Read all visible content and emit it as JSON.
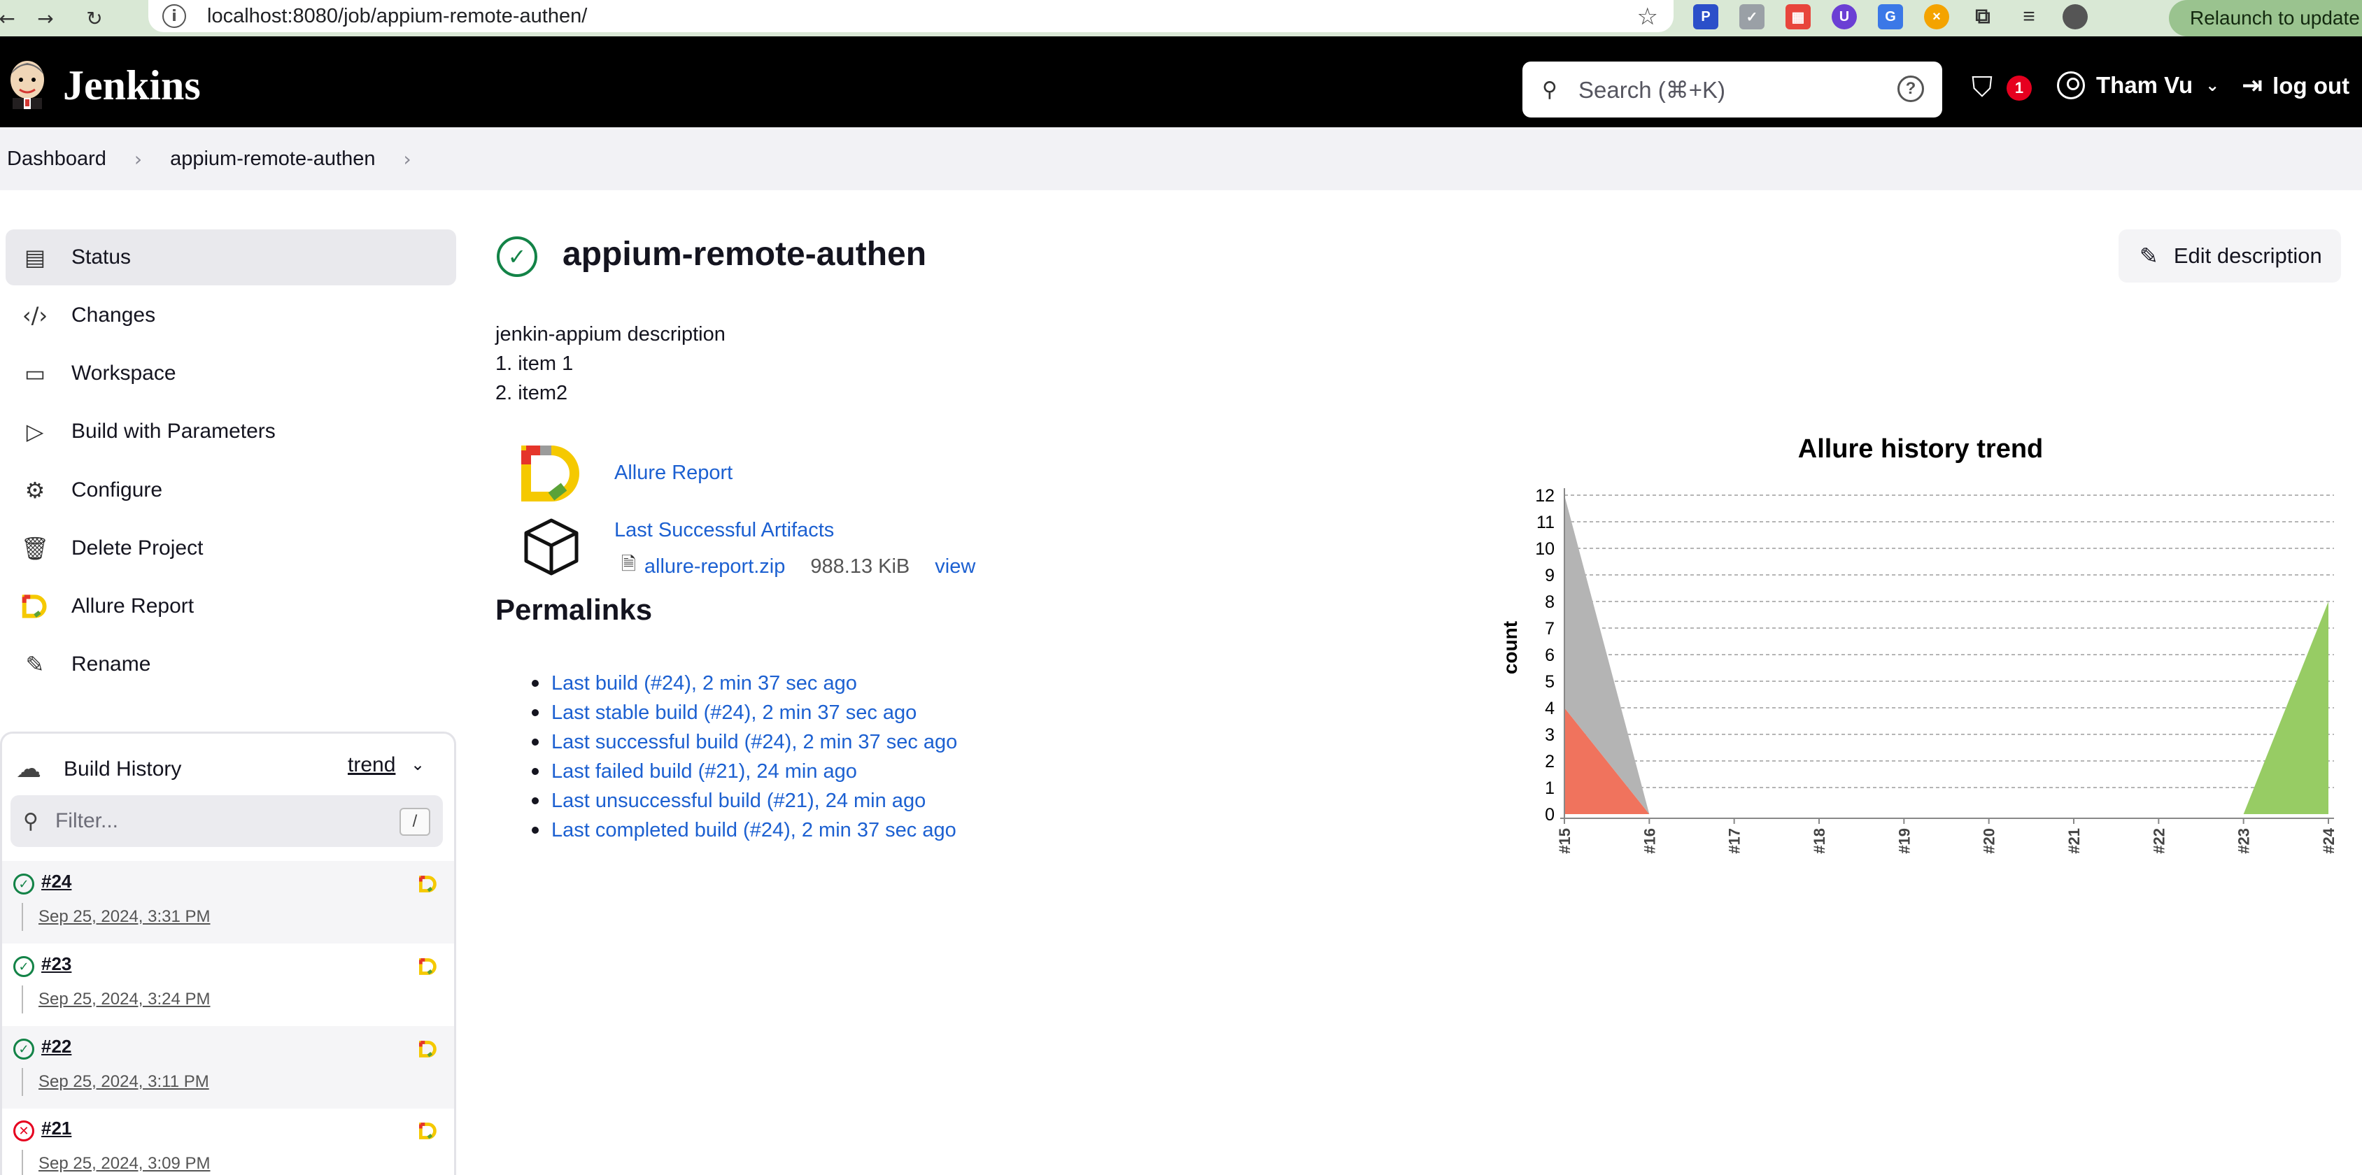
{
  "browser": {
    "url": "localhost:8080/job/appium-remote-authen/",
    "relaunch_label": "Relaunch to update"
  },
  "header": {
    "app_name": "Jenkins",
    "search_placeholder": "Search (⌘+K)",
    "security_count": "1",
    "user_name": "Tham Vu",
    "logout_label": "log out"
  },
  "breadcrumb": [
    "Dashboard",
    "appium-remote-authen"
  ],
  "sidebar": {
    "items": [
      {
        "label": "Status",
        "icon": "document-icon"
      },
      {
        "label": "Changes",
        "icon": "code-icon"
      },
      {
        "label": "Workspace",
        "icon": "folder-icon"
      },
      {
        "label": "Build with Parameters",
        "icon": "play-icon"
      },
      {
        "label": "Configure",
        "icon": "gear-icon"
      },
      {
        "label": "Delete Project",
        "icon": "trash-icon"
      },
      {
        "label": "Allure Report",
        "icon": "allure-icon"
      },
      {
        "label": "Rename",
        "icon": "pencil-icon"
      }
    ]
  },
  "build_history": {
    "title": "Build History",
    "trend_label": "trend",
    "filter_placeholder": "Filter...",
    "filter_shortcut": "/",
    "builds": [
      {
        "number": "#24",
        "date": "Sep 25, 2024, 3:31 PM",
        "status": "success"
      },
      {
        "number": "#23",
        "date": "Sep 25, 2024, 3:24 PM",
        "status": "success"
      },
      {
        "number": "#22",
        "date": "Sep 25, 2024, 3:11 PM",
        "status": "success"
      },
      {
        "number": "#21",
        "date": "Sep 25, 2024, 3:09 PM",
        "status": "failed"
      }
    ]
  },
  "main": {
    "title": "appium-remote-authen",
    "edit_description_label": "Edit description",
    "description_lines": [
      "jenkin-appium description",
      "1. item 1",
      "2. item2"
    ],
    "allure_report_label": "Allure Report",
    "last_successful_artifacts_label": "Last Successful Artifacts",
    "artifact": {
      "name": "allure-report.zip",
      "size": "988.13 KiB",
      "view_label": "view"
    },
    "permalinks_title": "Permalinks",
    "permalinks": [
      "Last build (#24), 2 min 37 sec ago",
      "Last stable build (#24), 2 min 37 sec ago",
      "Last successful build (#24), 2 min 37 sec ago",
      "Last failed build (#21), 24 min ago",
      "Last unsuccessful build (#21), 24 min ago",
      "Last completed build (#24), 2 min 37 sec ago"
    ]
  },
  "colors": {
    "success": "#138347",
    "failure": "#e6001f",
    "link": "#1c60d1",
    "chart_failed": "#f0735d",
    "chart_unknown": "#b4b4b4",
    "chart_passed": "#97cc64"
  },
  "chart_data": {
    "type": "area",
    "title": "Allure history trend",
    "ylabel": "count",
    "xlabel": "",
    "categories": [
      "#15",
      "#16",
      "#17",
      "#18",
      "#19",
      "#20",
      "#21",
      "#22",
      "#23",
      "#24"
    ],
    "ylim": [
      0,
      12
    ],
    "yticks": [
      0,
      1,
      2,
      3,
      4,
      5,
      6,
      7,
      8,
      9,
      10,
      11,
      12
    ],
    "stacked": true,
    "grid": true,
    "series": [
      {
        "key": "failed",
        "values": [
          4,
          0,
          0,
          0,
          0,
          0,
          0,
          0,
          0,
          0
        ],
        "color": "#f0735d"
      },
      {
        "key": "unknown",
        "values": [
          8,
          0,
          0,
          0,
          0,
          0,
          0,
          0,
          0,
          0
        ],
        "color": "#b4b4b4"
      },
      {
        "key": "passed",
        "values": [
          0,
          0,
          0,
          0,
          0,
          0,
          0,
          0,
          0,
          8
        ],
        "color": "#97cc64"
      }
    ]
  }
}
